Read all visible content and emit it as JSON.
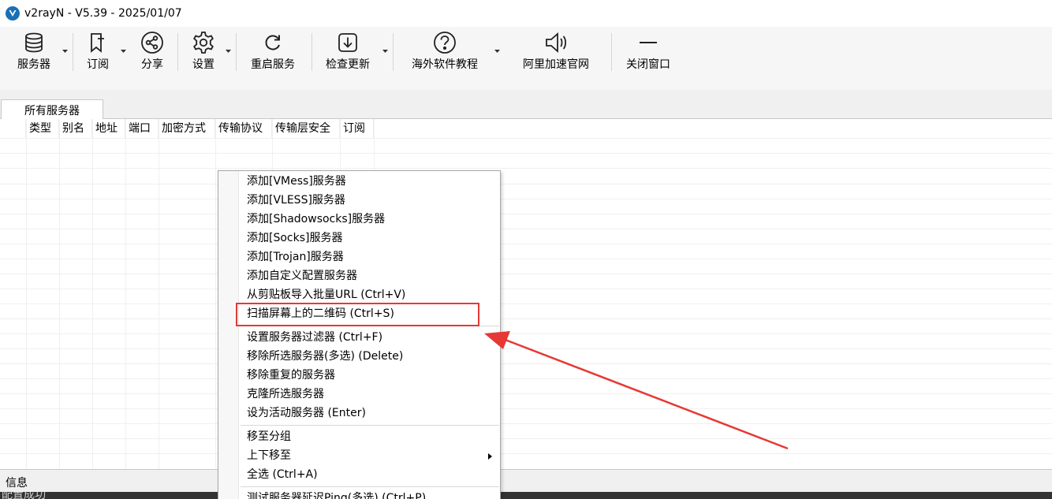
{
  "window": {
    "title": "v2rayN - V5.39 - 2025/01/07"
  },
  "toolbar": {
    "servers": "服务器",
    "subscribe": "订阅",
    "share": "分享",
    "settings": "设置",
    "restart": "重启服务",
    "update": "检查更新",
    "tutorial": "海外软件教程",
    "aliyun": "阿里加速官网",
    "close": "关闭窗口"
  },
  "tabs": [
    {
      "label": "所有服务器"
    }
  ],
  "grid": {
    "columns": [
      "类型",
      "别名",
      "地址",
      "端口",
      "加密方式",
      "传输协议",
      "传输层安全",
      "订阅"
    ]
  },
  "info": {
    "label": "信息",
    "console": "配置成功"
  },
  "context_menu": {
    "items": [
      "添加[VMess]服务器",
      "添加[VLESS]服务器",
      "添加[Shadowsocks]服务器",
      "添加[Socks]服务器",
      "添加[Trojan]服务器",
      "添加自定义配置服务器",
      "从剪贴板导入批量URL (Ctrl+V)",
      "扫描屏幕上的二维码 (Ctrl+S)",
      "设置服务器过滤器 (Ctrl+F)",
      "移除所选服务器(多选) (Delete)",
      "移除重复的服务器",
      "克隆所选服务器",
      "设为活动服务器 (Enter)",
      "移至分组",
      "上下移至",
      "全选 (Ctrl+A)",
      "测试服务器延迟Ping(多选) (Ctrl+P)"
    ]
  },
  "annotation": {
    "color": "#e53935"
  }
}
